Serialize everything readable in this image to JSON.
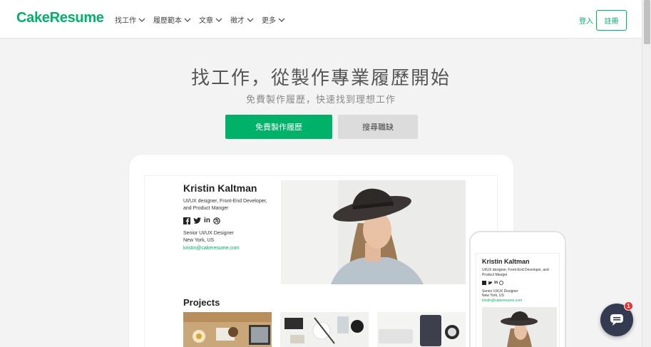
{
  "brand": {
    "logo": "CakeResume",
    "accent": "#00b16a"
  },
  "nav": {
    "items": [
      {
        "label": "找工作"
      },
      {
        "label": "履歷範本"
      },
      {
        "label": "文章"
      },
      {
        "label": "徵才"
      },
      {
        "label": "更多"
      }
    ],
    "login": "登入",
    "signup": "註冊"
  },
  "hero": {
    "title": "找工作，從製作專業履歷開始",
    "subtitle": "免費製作履歷，快速找到理想工作",
    "primary_button": "免費製作履歷",
    "secondary_button": "搜尋職缺"
  },
  "resume_preview": {
    "name": "Kristin Kaltman",
    "role": "UI/UX designer, Front-End Developer, and Product Manger",
    "job_title": "Senior UI/UX Designer",
    "location": "New York, US",
    "email": "kristin@cakeresume.com",
    "social_icons": [
      "facebook-icon",
      "twitter-icon",
      "linkedin-icon",
      "dribbble-icon"
    ],
    "projects_heading": "Projects"
  },
  "phone_preview": {
    "name": "Kristin Kaltman",
    "role": "UI/UX designer, Front-End Developer, and Product Manger",
    "job_title": "Senior UI/UX Designer",
    "location": "New York, US",
    "email": "kristin@cakeresume.com"
  },
  "chat": {
    "badge_count": "1",
    "icon": "chat-icon"
  }
}
